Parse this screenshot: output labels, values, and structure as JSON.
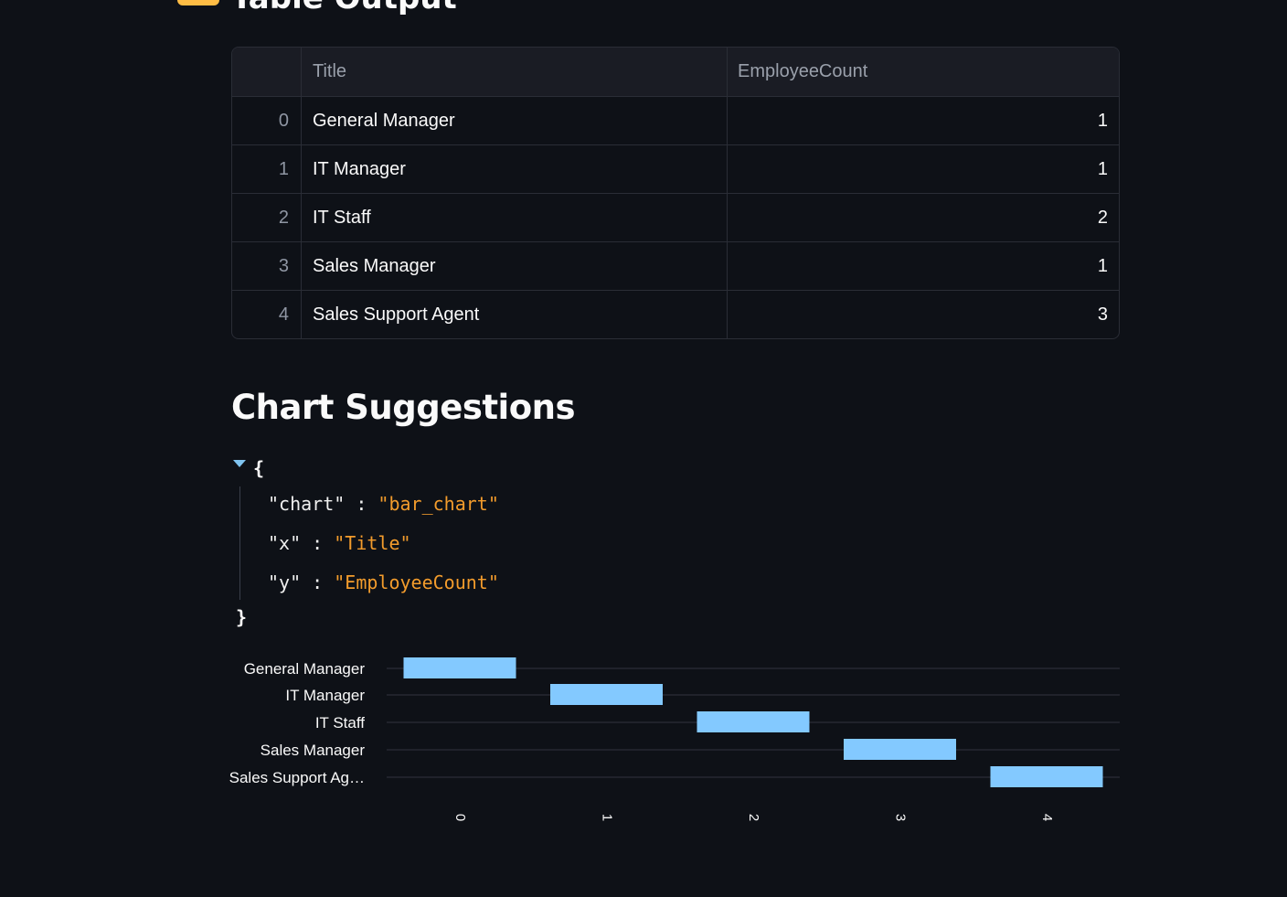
{
  "table_output": {
    "title": "Table Output",
    "columns": [
      "",
      "Title",
      "EmployeeCount"
    ],
    "rows": [
      {
        "index": "0",
        "title": "General Manager",
        "count": "1"
      },
      {
        "index": "1",
        "title": "IT Manager",
        "count": "1"
      },
      {
        "index": "2",
        "title": "IT Staff",
        "count": "2"
      },
      {
        "index": "3",
        "title": "Sales Manager",
        "count": "1"
      },
      {
        "index": "4",
        "title": "Sales Support Agent",
        "count": "3"
      }
    ]
  },
  "chart_suggestions": {
    "title": "Chart Suggestions",
    "json": {
      "open": "{",
      "close": "}",
      "entries": [
        {
          "key": "\"chart\"",
          "value": "\"bar_chart\""
        },
        {
          "key": "\"x\"",
          "value": "\"Title\""
        },
        {
          "key": "\"y\"",
          "value": "\"EmployeeCount\""
        }
      ]
    }
  },
  "chart_data": {
    "type": "bar",
    "orientation": "horizontal",
    "categories": [
      "General Manager",
      "IT Manager",
      "IT Staff",
      "Sales Manager",
      "Sales Support Ag…"
    ],
    "x_ticks": [
      "0",
      "1",
      "2",
      "3",
      "4"
    ],
    "bars": [
      {
        "category": "General Manager",
        "x": 0
      },
      {
        "category": "IT Manager",
        "x": 1
      },
      {
        "category": "IT Staff",
        "x": 2
      },
      {
        "category": "Sales Manager",
        "x": 3
      },
      {
        "category": "Sales Support Ag…",
        "x": 4
      }
    ],
    "bar_color": "#83c9ff",
    "gridline_color": "#31333f",
    "xlabel": "",
    "ylabel": ""
  }
}
